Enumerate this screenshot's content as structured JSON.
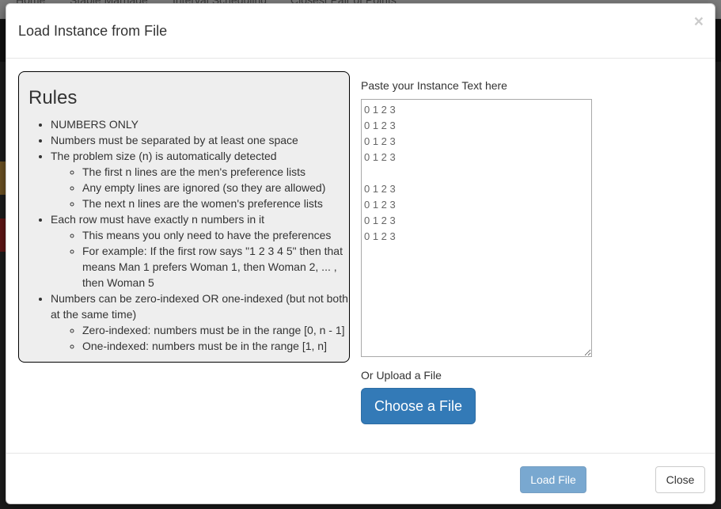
{
  "background_nav": {
    "items": [
      "Home",
      "Stable Marriage",
      "Interval Scheduling",
      "Closest Pair of Points"
    ]
  },
  "modal": {
    "title": "Load Instance from File",
    "close_glyph": "×"
  },
  "rules": {
    "heading": "Rules",
    "items": [
      {
        "text": "NUMBERS ONLY"
      },
      {
        "text": "Numbers must be separated by at least one space"
      },
      {
        "text": "The problem size (n) is automatically detected",
        "sub": [
          "The first n lines are the men's preference lists",
          "Any empty lines are ignored (so they are allowed)",
          "The next n lines are the women's preference lists"
        ]
      },
      {
        "text": "Each row must have exactly n numbers in it",
        "sub": [
          "This means you only need to have the preferences",
          "For example: If the first row says \"1 2 3 4 5\" then that means Man 1 prefers Woman 1, then Woman 2, ... , then Woman 5"
        ]
      },
      {
        "text": "Numbers can be zero-indexed OR one-indexed (but not both at the same time)",
        "sub": [
          "Zero-indexed: numbers must be in the range [0, n - 1]",
          "One-indexed: numbers must be in the range [1, n]"
        ]
      }
    ]
  },
  "paste": {
    "label": "Paste your Instance Text here",
    "value": "0 1 2 3\n0 1 2 3\n0 1 2 3\n0 1 2 3\n\n0 1 2 3\n0 1 2 3\n0 1 2 3\n0 1 2 3"
  },
  "upload": {
    "label": "Or Upload a File",
    "button_label": "Choose a File"
  },
  "footer": {
    "load_label": "Load File",
    "close_label": "Close"
  },
  "colors": {
    "primary": "#337ab7",
    "rules_bg": "#eeeeee"
  }
}
